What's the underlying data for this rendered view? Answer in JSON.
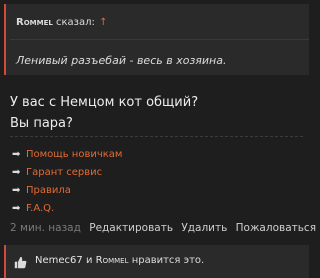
{
  "quote": {
    "author": "Rommel",
    "said": "сказал:",
    "arrow": "↑",
    "text": "Ленивый разъебай - весь в хозяина."
  },
  "message": {
    "line1": "У вас с Немцом кот общий?",
    "line2": "Вы пара?"
  },
  "links": [
    {
      "arrow": "➡",
      "label": "Помощь новичкам"
    },
    {
      "arrow": "➡",
      "label": "Гарант сервис"
    },
    {
      "arrow": "➡",
      "label": "Правила"
    },
    {
      "arrow": "➡",
      "label": "F.A.Q."
    }
  ],
  "actions": {
    "time": "2 мин. назад",
    "edit": "Редактировать",
    "delete": "Удалить",
    "report": "Пожаловаться"
  },
  "likes": {
    "user1": "Nemec67",
    "and": "и",
    "user2": "Rommel",
    "suffix": "нравится это."
  },
  "colors": {
    "background": "#1e1e1e",
    "panel": "#2a2a2a",
    "accent": "#e26a35",
    "quote_border": "#d14b3b"
  }
}
